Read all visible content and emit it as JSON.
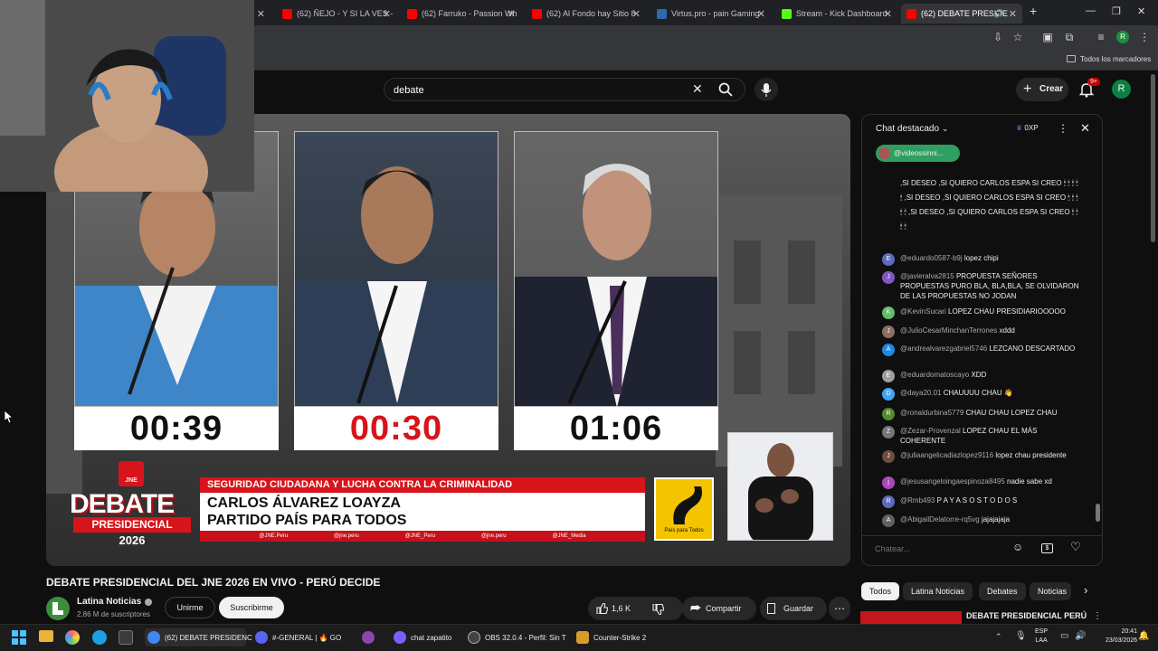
{
  "browser": {
    "tabs": [
      {
        "title": "(62) ÑEJO - Y SI LA VES -",
        "color": "#ff0000"
      },
      {
        "title": "(62) Farruko - Passion Wh",
        "color": "#ff0000"
      },
      {
        "title": "(62) Al Fondo hay Sitio 8",
        "color": "#ff0000"
      },
      {
        "title": "Virtus.pro - pain Gaming",
        "color": "#2b6cb0"
      },
      {
        "title": "Stream - Kick Dashboard",
        "color": "#53fc18"
      },
      {
        "title": "(62) DEBATE PRESIDE",
        "color": "#ff0000"
      }
    ],
    "bookmarks_label": "Todos los marcadores",
    "profile_initial": "R"
  },
  "youtube": {
    "search_value": "debate",
    "create_label": "Crear",
    "notif_badge": "9+",
    "avatar_initial": "R",
    "video_title": "DEBATE PRESIDENCIAL DEL JNE 2026 EN VIVO - PERÚ DECIDE",
    "channel_name": "Latina Noticias",
    "subscribers": "2,86 M de suscriptores",
    "join_label": "Unirme",
    "subscribe_label": "Suscribirme",
    "likes": "1,6 K",
    "share_label": "Compartir",
    "save_label": "Guardar",
    "filter_chips": [
      "Todos",
      "Latina Noticias",
      "Debates",
      "Noticias"
    ],
    "related_title": "DEBATE PRESIDENCIAL PERÚ"
  },
  "video": {
    "timers": [
      "00:39",
      "00:30",
      "01:06"
    ],
    "banner_topic": "SEGURIDAD CIUDADANA Y LUCHA CONTRA LA CRIMINALIDAD",
    "banner_name": "CARLOS ÁLVAREZ LOAYZA",
    "banner_party": "PARTIDO PAÍS PARA TODOS",
    "socials": [
      "@JNE.Peru",
      "@jne.peru",
      "@JNE_Peru",
      "@jne.peru",
      "@JNE_Media"
    ],
    "logo_top": "JNE",
    "logo_debate": "DEBATE",
    "logo_presidencial": "PRESIDENCIAL",
    "logo_year": "2026",
    "party_logo_text": "País para Todos"
  },
  "chat": {
    "header": "Chat destacado",
    "points": "0XP",
    "pinned_user": "@videossinni...",
    "input_placeholder": "Chatear...",
    "top_message": ",SI DESEO ,SI QUIERO CARLOS ESPA SI CREO 🕯 🕯 🕯 🕯 🕯 ,SI DESEO ,SI QUIERO CARLOS ESPA SI CREO 🕯 🕯 🕯 🕯 🕯 ,SI DESEO ,SI QUIERO CARLOS ESPA SI CREO 🕯 🕯 🕯 🕯",
    "messages": [
      {
        "author": "@eduardo0587-b9j",
        "text": "lopez chipi",
        "initial": "E",
        "color": "#5c6bc0"
      },
      {
        "author": "@javieralva2815",
        "text": "PROPUESTA SEÑORES PROPUESTAS PURO BLA, BLA,BLA, SE OLVIDARON DE LAS PROPUESTAS NO JODAN",
        "initial": "J",
        "color": "#7e57c2"
      },
      {
        "author": "@KevinSucari",
        "text": "LOPEZ CHAU PRESIDIARIOOOOO",
        "initial": "K",
        "color": "#66bb6a"
      },
      {
        "author": "@JulioCesarMinchanTerrones",
        "text": "xddd",
        "initial": "J",
        "color": "#8d6e63"
      },
      {
        "author": "@andrealvarezgabriel5746",
        "text": "LEZCANO DESCARTADO",
        "initial": "A",
        "color": "#1e88e5"
      },
      {
        "author": "@eduardomatoscayo",
        "text": "XDD",
        "initial": "E",
        "color": "#9e9e9e"
      },
      {
        "author": "@daya20.01",
        "text": "CHAUUUU CHAU 👋",
        "initial": "D",
        "color": "#42a5f5"
      },
      {
        "author": "@ronaldurbina5779",
        "text": "CHAU CHAU LOPEZ CHAU",
        "initial": "R",
        "color": "#558b2f"
      },
      {
        "author": "@Zezar-Provenzal",
        "text": "LOPEZ CHAU EL MÁS COHERENTE",
        "initial": "Z",
        "color": "#757575"
      },
      {
        "author": "@juliaangelicadiazlopez9116",
        "text": "lopez chau presidente",
        "initial": "J",
        "color": "#6d4c41"
      },
      {
        "author": "@jesusangeloingaespinoza8495",
        "text": "nadie sabe xd",
        "initial": "j",
        "color": "#ab47bc"
      },
      {
        "author": "@Rmb493",
        "text": "P A Y A S O S T O D O S",
        "initial": "R",
        "color": "#5c6bc0"
      },
      {
        "author": "@AbigailDelatorre-rq5vg",
        "text": "jajajajaja",
        "initial": "A",
        "color": "#616161"
      }
    ]
  },
  "taskbar": {
    "apps": [
      {
        "label": "(62) DEBATE PRESIDENC",
        "color": "#4285f4"
      },
      {
        "label": "#-GENERAL | 🔥 GO",
        "color": "#5865f2"
      },
      {
        "label": "",
        "color": "#8e44ad"
      },
      {
        "label": "chat zapatito",
        "color": "#7d5fff"
      },
      {
        "label": "OBS 32.0.4 - Perfil: Sin T",
        "color": "#444"
      },
      {
        "label": "Counter-Strike 2",
        "color": "#d89c2b"
      }
    ],
    "lang_top": "ESP",
    "lang_bottom": "LAA",
    "time": "20:41",
    "date": "23/03/2026"
  }
}
